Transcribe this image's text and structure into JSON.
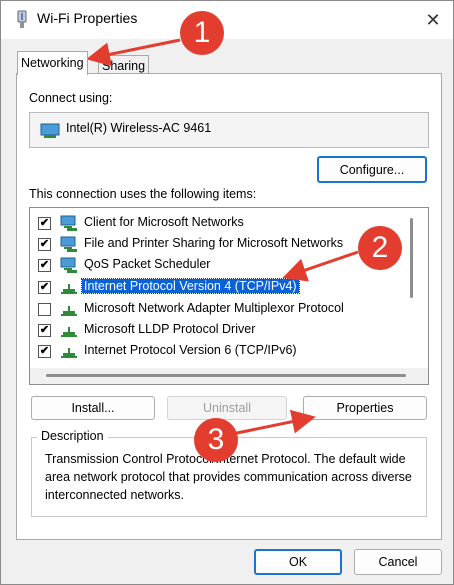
{
  "window": {
    "title": "Wi-Fi Properties",
    "close_glyph": "✕"
  },
  "tabs": [
    {
      "label": "Networking"
    },
    {
      "label": "Sharing"
    }
  ],
  "connect_using": {
    "label": "Connect using:",
    "adapter_name": "Intel(R) Wireless-AC 9461",
    "configure_label": "Configure..."
  },
  "items_section": {
    "label": "This connection uses the following items:",
    "items": [
      {
        "label": "Client for Microsoft Networks",
        "checked": true
      },
      {
        "label": "File and Printer Sharing for Microsoft Networks",
        "checked": true
      },
      {
        "label": "QoS Packet Scheduler",
        "checked": true
      },
      {
        "label": "Internet Protocol Version 4 (TCP/IPv4)",
        "checked": true,
        "selected": true
      },
      {
        "label": "Microsoft Network Adapter Multiplexor Protocol",
        "checked": false
      },
      {
        "label": "Microsoft LLDP Protocol Driver",
        "checked": true
      },
      {
        "label": "Internet Protocol Version 6 (TCP/IPv6)",
        "checked": true
      }
    ],
    "check_glyph": "✔"
  },
  "actions": {
    "install": "Install...",
    "uninstall": "Uninstall",
    "properties": "Properties"
  },
  "description": {
    "label": "Description",
    "text": "Transmission Control Protocol/Internet Protocol. The default wide area network protocol that provides communication across diverse interconnected networks."
  },
  "dialog_buttons": {
    "ok": "OK",
    "cancel": "Cancel"
  },
  "annotations": {
    "badge1": "1",
    "badge2": "2",
    "badge3": "3"
  },
  "colors": {
    "annotation": "#e23d2e",
    "selection": "#0b62d6",
    "primary_border": "#1a73d0"
  }
}
